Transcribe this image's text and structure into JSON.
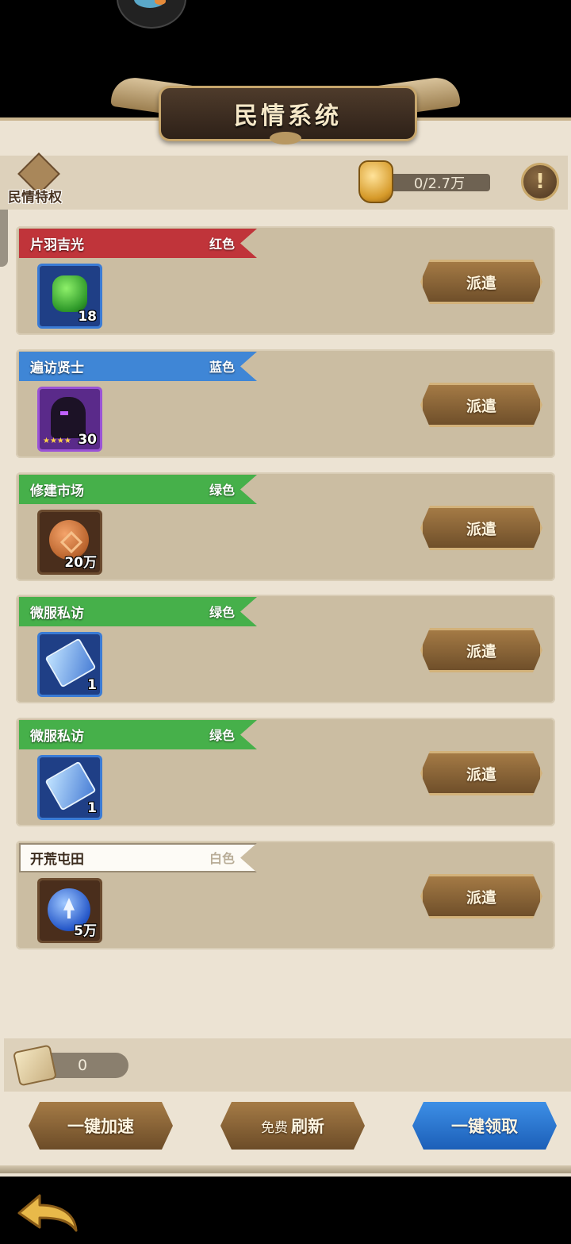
{
  "header": {
    "title": "民情系统",
    "privilege_label": "民情特权",
    "power_value": "0/2.7万",
    "info_icon": "exclamation-icon"
  },
  "tasks": [
    {
      "name": "片羽吉光",
      "grade": "红色",
      "color": "#c0343a",
      "item": "green-gem",
      "count": "18",
      "frame": "#3a7bd5"
    },
    {
      "name": "遍访贤士",
      "grade": "蓝色",
      "color": "#3f86d6",
      "item": "hero-silhouette",
      "count": "30",
      "frame": "#9a52d6"
    },
    {
      "name": "修建市场",
      "grade": "绿色",
      "color": "#46b04a",
      "item": "copper-coin",
      "count": "20万",
      "frame": "#6a4a2e"
    },
    {
      "name": "微服私访",
      "grade": "绿色",
      "color": "#46b04a",
      "item": "blue-card",
      "count": "1",
      "frame": "#3a7bd5"
    },
    {
      "name": "微服私访",
      "grade": "绿色",
      "color": "#46b04a",
      "item": "blue-card",
      "count": "1",
      "frame": "#3a7bd5"
    },
    {
      "name": "开荒屯田",
      "grade": "白色",
      "color": "#fdfbf6",
      "item": "blue-orb",
      "count": "5万",
      "frame": "#6a4a2e"
    }
  ],
  "dispatch_label": "派遣",
  "scroll_count": "0",
  "actions": {
    "speed_up": "一键加速",
    "refresh_free": "免费",
    "refresh": "刷新",
    "claim_all": "一键领取"
  },
  "colors": {
    "panel": "#ece3d3",
    "card": "#cbbda2",
    "button_gold": "#a47a45",
    "button_blue": "#3d8fe6"
  }
}
